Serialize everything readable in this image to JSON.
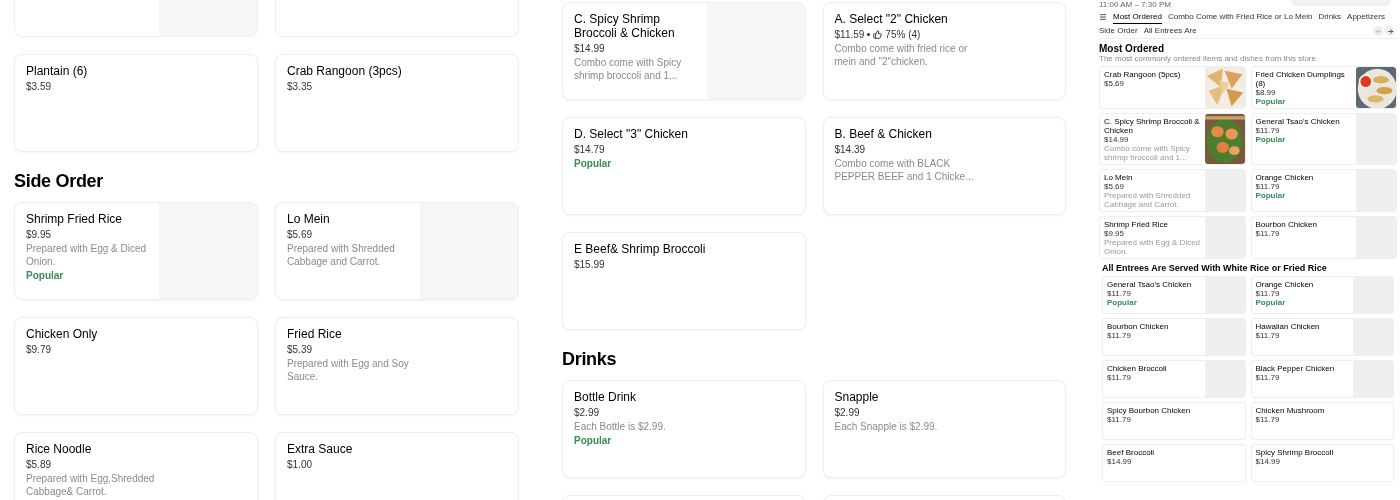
{
  "panels": [
    {
      "blocks": [
        {
          "kind": "cut_row",
          "cards": [
            {
              "kind": "placeholder"
            },
            {
              "kind": "plain"
            }
          ]
        },
        {
          "kind": "cards",
          "cards": [
            {
              "name": "Plantain (6)",
              "price": "$3.59"
            },
            {
              "name": "Crab Rangoon (3pcs)",
              "price": "$3.35"
            }
          ]
        },
        {
          "kind": "heading",
          "text": "Side Order"
        },
        {
          "kind": "cards",
          "cards": [
            {
              "name": "Shrimp Fried Rice",
              "price": "$9.95",
              "description": "Prepared with Egg & Diced Onion.",
              "badge": "Popular",
              "kind": "placeholder"
            },
            {
              "name": "Lo Mein",
              "price": "$5.69",
              "description": "Prepared with Shredded Cabbage and Carrot.",
              "kind": "placeholder"
            }
          ]
        },
        {
          "kind": "cards",
          "cards": [
            {
              "name": "Chicken Only",
              "price": "$9.79"
            },
            {
              "name": "Fried Rice",
              "price": "$5.39",
              "description": "Prepared with Egg and Soy Sauce."
            }
          ]
        },
        {
          "kind": "cards",
          "cards": [
            {
              "name": "Rice Noodle",
              "price": "$5.89",
              "description": "Prepared with Egg,Shredded Cabbage& Carrot."
            },
            {
              "name": "Extra Sauce",
              "price": "$1.00"
            }
          ]
        }
      ]
    },
    {
      "blocks": [
        {
          "kind": "cards",
          "cards": [
            {
              "name": "C. Spicy Shrimp Broccoli & Chicken",
              "price": "$14.99",
              "description": "Combo come with Spicy shrimp broccoli and 1...",
              "kind": "placeholder"
            },
            {
              "name": "A. Select \"2\" Chicken",
              "price": "$11.59",
              "rating": "75% (4)",
              "description": "Combo come with fried rice or mein and \"2\"chicken."
            }
          ]
        },
        {
          "kind": "cards",
          "cards": [
            {
              "name": "D. Select \"3\" Chicken",
              "price": "$14.79",
              "badge": "Popular"
            },
            {
              "name": "B. Beef & Chicken",
              "price": "$14.39",
              "description": "Combo come with BLACK PEPPER BEEF and 1 Chicke..."
            }
          ]
        },
        {
          "kind": "cards",
          "cards": [
            {
              "name": "E Beef& Shrimp Broccoli",
              "price": "$15.99"
            }
          ]
        },
        {
          "kind": "heading",
          "text": "Drinks"
        },
        {
          "kind": "cards",
          "cards": [
            {
              "name": "Bottle Drink",
              "price": "$2.99",
              "description": "Each Bottle is $2.99.",
              "badge": "Popular"
            },
            {
              "name": "Snapple",
              "price": "$2.99",
              "description": "Each Snapple is $2.99."
            }
          ]
        },
        {
          "kind": "cut_row",
          "cards": [
            {
              "kind": "plain"
            },
            {
              "kind": "plain"
            }
          ]
        }
      ]
    }
  ],
  "preview": {
    "hours": "11:00 AM – 7:30 PM",
    "tabs": [
      {
        "label": "Most Ordered",
        "selected": true
      },
      {
        "label": "Combo Come with Fried Rice or Lo Mein",
        "selected": false
      },
      {
        "label": "Drinks",
        "selected": false
      },
      {
        "label": "Appetizers",
        "selected": false
      },
      {
        "label": "Side Order",
        "selected": false
      },
      {
        "label": "All Entrees Are",
        "selected": false
      }
    ],
    "sections": [
      {
        "title": "Most Ordered",
        "subtitle": "The most commonly ordered items and dishes from this store",
        "cards": [
          {
            "name": "Crab Rangoon (5pcs)",
            "price": "$5.69",
            "kind": "picture"
          },
          {
            "name": "Fried Chicken Dumplings (8)",
            "price": "$8.99",
            "badge": "Popular",
            "kind": "picture"
          },
          {
            "name": "C. Spicy Shrimp Broccoli & Chicken",
            "price": "$14.99",
            "description": "Combo come with Spicy shrimp broccoli and 1...",
            "kind": "picture"
          },
          {
            "name": "General Tsao's Chicken",
            "price": "$11.79",
            "badge": "Popular",
            "kind": "placeholder"
          },
          {
            "name": "Lo Mein",
            "price": "$5.69",
            "description": "Prepared with Shredded Cabbage and Carrot.",
            "kind": "placeholder"
          },
          {
            "name": "Orange Chicken",
            "price": "$11.79",
            "badge": "Popular",
            "kind": "placeholder"
          },
          {
            "name": "Shrimp Fried Rice",
            "price": "$9.95",
            "description": "Prepared with Egg & Diced Onion.",
            "kind": "placeholder"
          },
          {
            "name": "Bourbon Chicken",
            "price": "$11.79",
            "kind": "placeholder"
          }
        ]
      },
      {
        "title": "All Entrees Are Served With White Rice or Fried Rice",
        "cards": [
          {
            "name": "General Tsao's Chicken",
            "price": "$11.79",
            "badge": "Popular",
            "kind": "placeholder"
          },
          {
            "name": "Orange Chicken",
            "price": "$11.79",
            "badge": "Popular",
            "kind": "placeholder"
          },
          {
            "name": "Bourbon Chicken",
            "price": "$11.79",
            "kind": "placeholder"
          },
          {
            "name": "Hawaiian Chicken",
            "price": "$11.79",
            "kind": "placeholder"
          },
          {
            "name": "Chicken Broccoli",
            "price": "$11.79",
            "kind": "placeholder"
          },
          {
            "name": "Black Pepper Chicken",
            "price": "$11.79",
            "kind": "placeholder"
          },
          {
            "name": "Spicy Bourbon Chicken",
            "price": "$11.79"
          },
          {
            "name": "Chicken Mushroom",
            "price": "$11.79"
          },
          {
            "name": "Beef Broccoli",
            "price": "$14.99"
          },
          {
            "name": "Spicy Shrimp Broccoli",
            "price": "$14.99"
          }
        ]
      }
    ]
  }
}
